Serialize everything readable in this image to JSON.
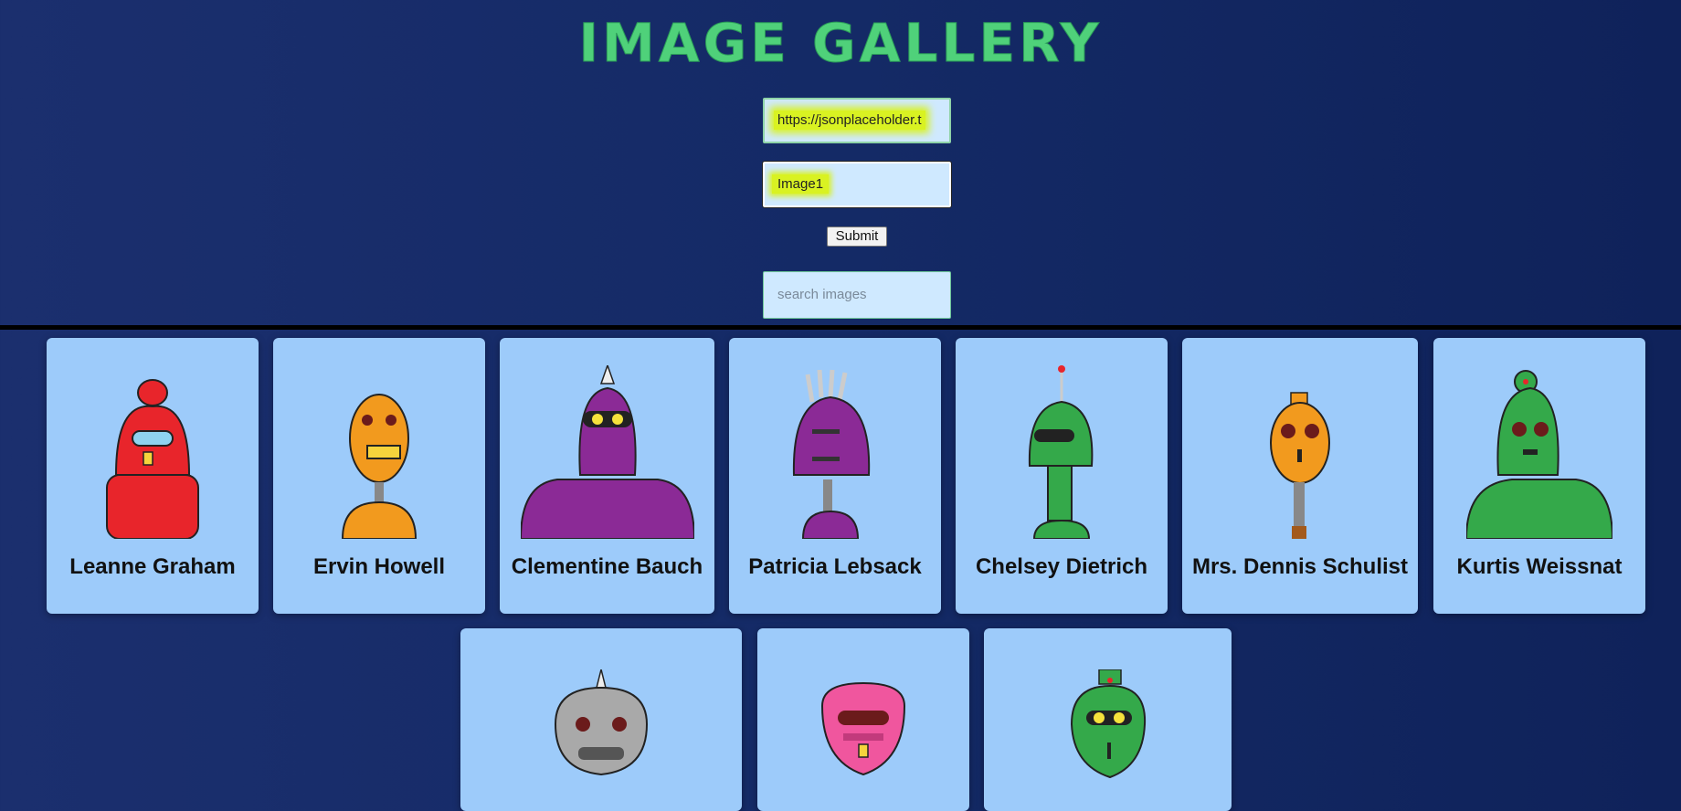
{
  "title": "IMAGE GALLERY",
  "form": {
    "url_value": "https://jsonplaceholder.t",
    "name_value": "Image1",
    "submit_label": "Submit",
    "search_placeholder": "search images"
  },
  "cards": [
    {
      "name": "Leanne Graham",
      "color": "#e8252b"
    },
    {
      "name": "Ervin Howell",
      "color": "#f29a1e"
    },
    {
      "name": "Clementine Bauch",
      "color": "#8b2a96"
    },
    {
      "name": "Patricia Lebsack",
      "color": "#8b2a96"
    },
    {
      "name": "Chelsey Dietrich",
      "color": "#34a94a"
    },
    {
      "name": "Mrs. Dennis Schulist",
      "color": "#f29a1e"
    },
    {
      "name": "Kurtis Weissnat",
      "color": "#34a94a"
    }
  ],
  "cards_row2": [
    {
      "color": "#a9a9a9"
    },
    {
      "color": "#f0569e"
    },
    {
      "color": "#34a94a"
    }
  ],
  "colors": {
    "title": "#4fd17a",
    "card_bg": "#9dcbfa",
    "field_bg": "#cfe9ff",
    "highlight": "#d9f222"
  }
}
